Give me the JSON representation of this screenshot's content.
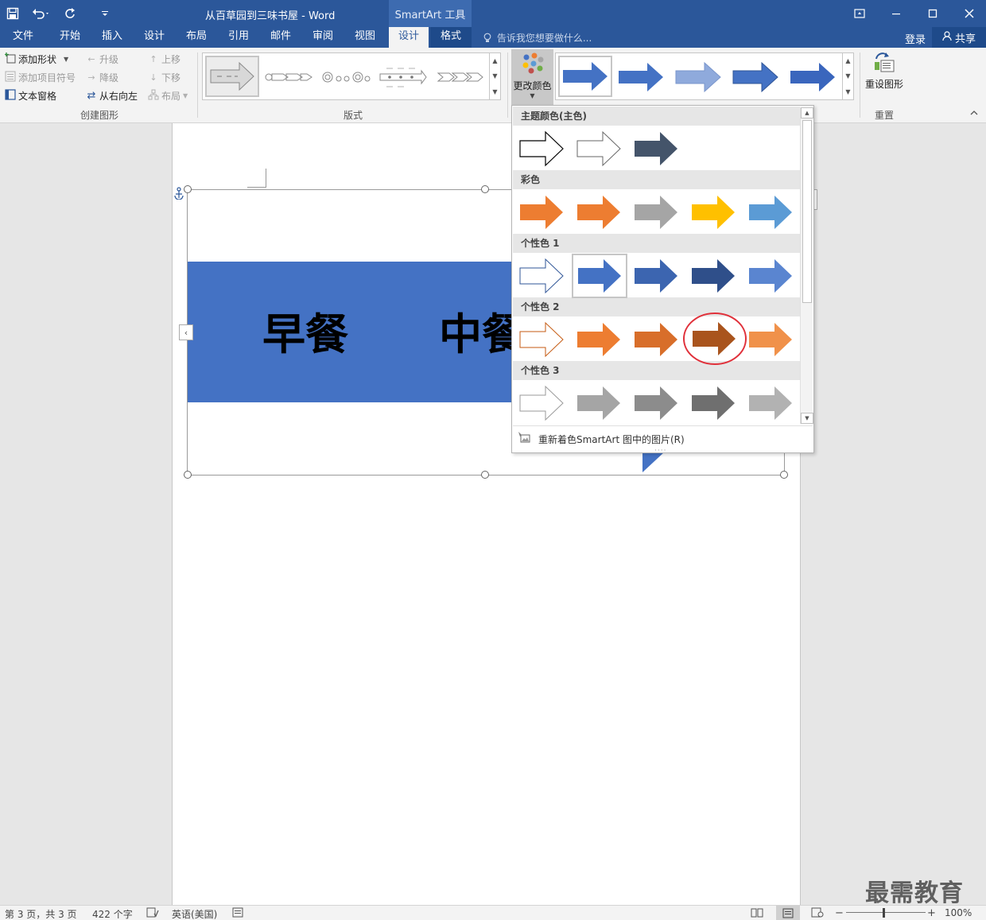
{
  "app": {
    "doc_title": "从百草园到三味书屋 - Word",
    "context_tab": "SmartArt 工具"
  },
  "tabs": [
    {
      "label": "文件",
      "state": "normal"
    },
    {
      "label": "开始",
      "state": "normal"
    },
    {
      "label": "插入",
      "state": "normal"
    },
    {
      "label": "设计",
      "state": "normal"
    },
    {
      "label": "布局",
      "state": "normal"
    },
    {
      "label": "引用",
      "state": "normal"
    },
    {
      "label": "邮件",
      "state": "normal"
    },
    {
      "label": "审阅",
      "state": "normal"
    },
    {
      "label": "视图",
      "state": "normal"
    },
    {
      "label": "设计",
      "state": "active"
    },
    {
      "label": "格式",
      "state": "dark"
    }
  ],
  "tellme": "告诉我您想要做什么...",
  "account": {
    "login": "登录",
    "share": "共享"
  },
  "ribbon": {
    "create_graphic": {
      "label": "创建图形",
      "add_shape": "添加形状",
      "add_bullet": "添加项目符号",
      "text_pane": "文本窗格",
      "promote": "升级",
      "demote": "降级",
      "right_to_left": "从右向左",
      "move_up": "上移",
      "move_down": "下移",
      "layout": "布局"
    },
    "layouts_label": "版式",
    "change_colors": "更改颜色",
    "reset": {
      "label": "重置",
      "button": "重设图形"
    }
  },
  "smartart": {
    "item1": "早餐",
    "item2": "中餐"
  },
  "color_menu": {
    "sections": [
      {
        "title": "主题颜色(主色)"
      },
      {
        "title": "彩色"
      },
      {
        "title": "个性色 1"
      },
      {
        "title": "个性色 2"
      },
      {
        "title": "个性色 3"
      }
    ],
    "footer": "重新着色SmartArt 图中的图片(R)"
  },
  "colors": {
    "accent": "#2b579a",
    "smartart_fill": "#4472c4",
    "highlight_circle": "#e0303a"
  },
  "status": {
    "pages": "第 3 页，共 3 页",
    "words": "422 个字",
    "language": "英语(美国)",
    "zoom": "100%"
  },
  "watermark": "最需教育"
}
